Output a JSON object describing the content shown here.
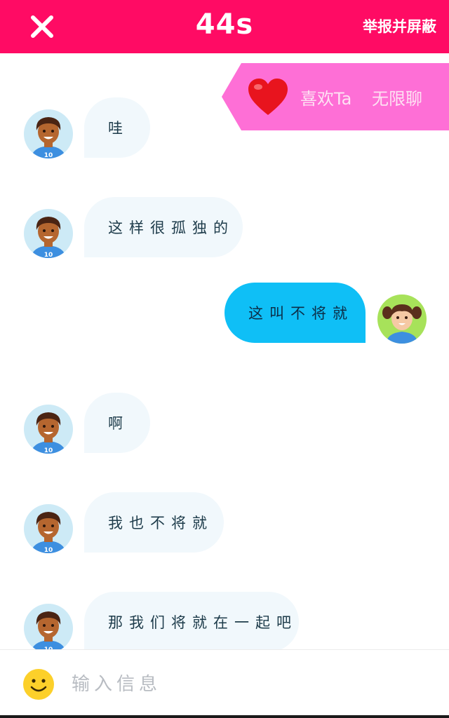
{
  "header": {
    "close_icon": "close-icon",
    "timer": "44s",
    "report_label": "举报并屏蔽",
    "background": "#ff0b64"
  },
  "like_banner": {
    "heart_icon": "heart-icon",
    "like_label": "喜欢Ta",
    "unlimited_label": "无限聊",
    "background": "#fe6fd6"
  },
  "messages": [
    {
      "side": "incoming",
      "avatar": "boy-avatar",
      "text": "哇"
    },
    {
      "side": "incoming",
      "avatar": "boy-avatar",
      "text": "这样很孤独的"
    },
    {
      "side": "outgoing",
      "avatar": "girl-avatar",
      "text": "这叫不将就"
    },
    {
      "side": "incoming",
      "avatar": "boy-avatar",
      "text": "啊"
    },
    {
      "side": "incoming",
      "avatar": "boy-avatar",
      "text": "我也不将就"
    },
    {
      "side": "incoming",
      "avatar": "boy-avatar",
      "text": "那我们将就在一起吧"
    }
  ],
  "composer": {
    "emoji_icon": "smiley-icon",
    "placeholder": "输入信息"
  },
  "colors": {
    "incoming_bubble": "#f1f8fc",
    "outgoing_bubble": "#0fbff6"
  }
}
